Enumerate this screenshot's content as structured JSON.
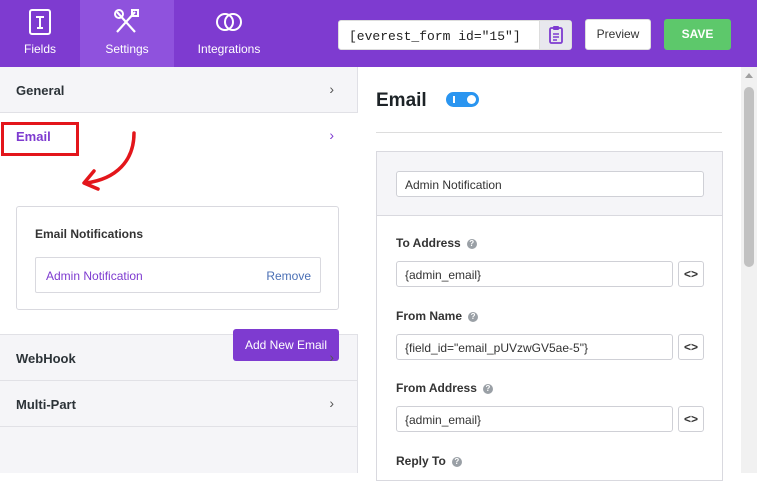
{
  "topbar": {
    "tabs": [
      {
        "label": "Fields",
        "icon": "form-fields-icon"
      },
      {
        "label": "Settings",
        "icon": "tools-icon"
      },
      {
        "label": "Integrations",
        "icon": "rings-icon"
      }
    ],
    "active_tab": "Settings",
    "shortcode": "[everest_form id=\"15\"]",
    "preview_label": "Preview",
    "save_label": "SAVE"
  },
  "sidebar": {
    "sections": {
      "general": "General",
      "email": "Email",
      "webhook": "WebHook",
      "multipart": "Multi-Part"
    },
    "notifications_title": "Email Notifications",
    "notification_name": "Admin Notification",
    "remove_label": "Remove",
    "add_new_label": "Add New Email"
  },
  "email_panel": {
    "title": "Email",
    "notification_name_value": "Admin Notification",
    "fields": {
      "to_address": {
        "label": "To Address",
        "value": "{admin_email}"
      },
      "from_name": {
        "label": "From Name",
        "value": "{field_id=\"email_pUVzwGV5ae-5\"}"
      },
      "from_address": {
        "label": "From Address",
        "value": "{admin_email}"
      },
      "reply_to": {
        "label": "Reply To"
      }
    }
  },
  "colors": {
    "brand": "#7e3bd0",
    "save": "#5dc86b",
    "highlight": "#e3161b",
    "toggle": "#2a95f0"
  }
}
